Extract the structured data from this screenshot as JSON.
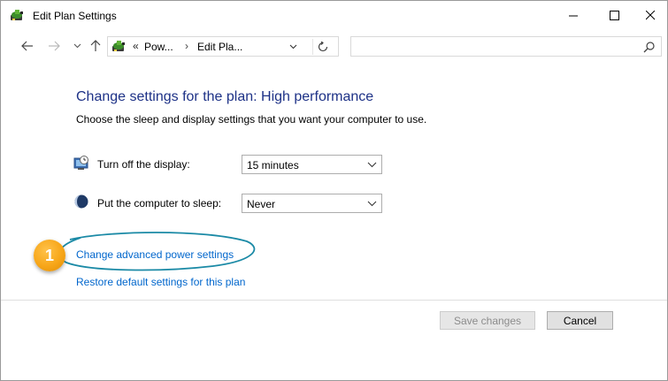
{
  "window": {
    "title": "Edit Plan Settings",
    "controls": {
      "minimize": "—",
      "maximize": "☐",
      "close": "✕"
    }
  },
  "nav": {
    "back_icon": "arrow-left",
    "forward_icon": "arrow-right",
    "recent_icon": "chevron-down",
    "up_icon": "arrow-up",
    "address": {
      "overflow": "«",
      "crumbs": [
        "Pow...",
        "Edit Pla..."
      ],
      "separator": "›"
    },
    "search": {
      "placeholder": ""
    }
  },
  "content": {
    "heading": "Change settings for the plan: High performance",
    "subtext": "Choose the sleep and display settings that you want your computer to use.",
    "settings": [
      {
        "label": "Turn off the display:",
        "value": "15 minutes",
        "icon": "display-clock-icon"
      },
      {
        "label": "Put the computer to sleep:",
        "value": "Never",
        "icon": "sleep-moon-icon"
      }
    ],
    "links": {
      "advanced": "Change advanced power settings",
      "restore": "Restore default settings for this plan"
    },
    "callout": {
      "number": "1"
    }
  },
  "buttons": {
    "save": "Save changes",
    "cancel": "Cancel"
  },
  "colors": {
    "heading": "#1e3287",
    "link": "#0066cc",
    "callout": "#f7a619",
    "annotation_ring": "#1b8aa6"
  }
}
